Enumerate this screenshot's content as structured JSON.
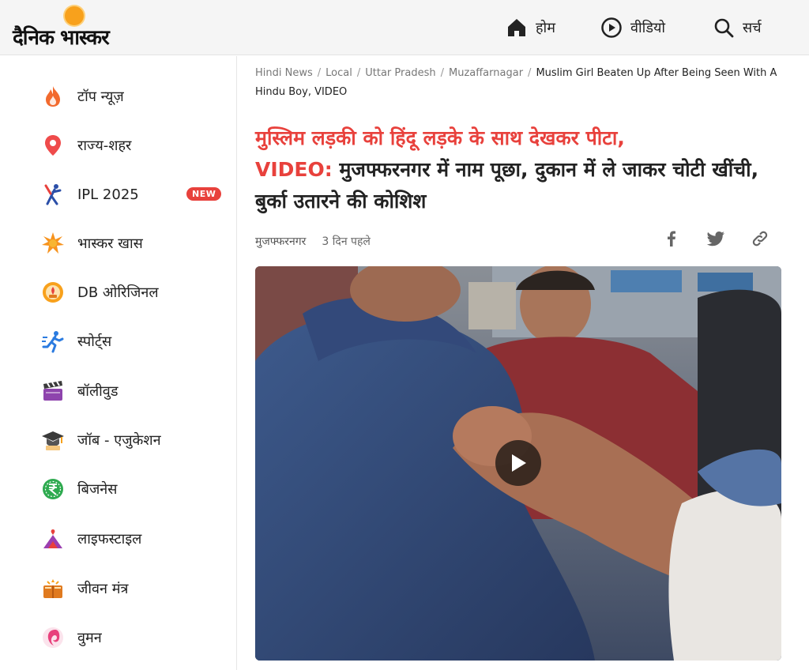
{
  "header": {
    "logo_text": "दैनिक भास्कर",
    "nav": [
      {
        "label": "होम",
        "icon": "home-icon"
      },
      {
        "label": "वीडियो",
        "icon": "play-circle-icon"
      },
      {
        "label": "सर्च",
        "icon": "search-icon"
      }
    ]
  },
  "sidebar": {
    "items": [
      {
        "label": "टॉप न्यूज़",
        "icon": "flame-icon"
      },
      {
        "label": "राज्य-शहर",
        "icon": "location-pin-icon"
      },
      {
        "label": "IPL 2025",
        "icon": "cricket-icon",
        "badge": "NEW"
      },
      {
        "label": "भास्कर खास",
        "icon": "star-burst-icon"
      },
      {
        "label": "DB ओरिजिनल",
        "icon": "db-original-icon"
      },
      {
        "label": "स्पोर्ट्स",
        "icon": "running-icon"
      },
      {
        "label": "बॉलीवुड",
        "icon": "clapperboard-icon"
      },
      {
        "label": "जॉब - एजुकेशन",
        "icon": "graduation-cap-icon"
      },
      {
        "label": "बिजनेस",
        "icon": "rupee-icon"
      },
      {
        "label": "लाइफस्टाइल",
        "icon": "lifestyle-icon"
      },
      {
        "label": "जीवन मंत्र",
        "icon": "book-icon"
      },
      {
        "label": "वुमन",
        "icon": "women-icon"
      }
    ]
  },
  "breadcrumb": {
    "items": [
      "Hindi News",
      "Local",
      "Uttar Pradesh",
      "Muzaffarnagar"
    ],
    "current": "Muslim Girl Beaten Up After Being Seen With A Hindu Boy, VIDEO"
  },
  "article": {
    "headline_red_1": "मुस्लिम लड़की को हिंदू लड़के के साथ देखकर पीटा,",
    "headline_red_2": "VIDEO:",
    "headline_rest": " मुजफ्फरनगर में नाम पूछा, दुकान में ले जाकर चोटी खींची, बुर्का उतारने की कोशिश",
    "location": "मुजफ्फरनगर",
    "time": "3 दिन पहले"
  },
  "share": [
    "facebook-icon",
    "twitter-icon",
    "link-icon"
  ],
  "colors": {
    "accent": "#e8413c",
    "logo_sun": "#f8a11c"
  }
}
